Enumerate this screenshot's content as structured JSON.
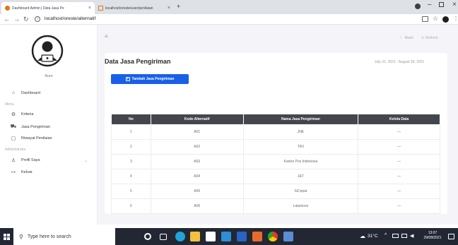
{
  "browser": {
    "tabs": [
      {
        "label": "Dashboard Admin | Data Jasa Pe"
      },
      {
        "label": "localhost/oreste/user/penilaian"
      }
    ],
    "new_tab": "+",
    "address": "localhost/oreste/alternatif"
  },
  "sidebar": {
    "profile_name": "Aure",
    "dashboard": "Dashboard",
    "menu_section": "Menu",
    "items": [
      {
        "label": "Kriteria",
        "icon": "filter-icon"
      },
      {
        "label": "Jasa Pengiriman",
        "icon": "truck-icon"
      },
      {
        "label": "Riwayat Penilaian",
        "icon": "document-icon"
      }
    ],
    "admin_section": "Administrator",
    "profil": "Profil Saya",
    "keluar": "Keluar"
  },
  "topbar": {
    "mode": "Mode",
    "refresh": "Refresh"
  },
  "page": {
    "title": "Data Jasa Pengiriman",
    "date_range": "July 31, 2021 - August 29, 2021",
    "add_button": "Tambah Jasa Pengiriman"
  },
  "table": {
    "headers": [
      "No",
      "Kode Alternatif",
      "Nama Jasa Pengiriman",
      "Kelola Data"
    ],
    "rows": [
      [
        "1",
        "A01",
        "JNE",
        "—"
      ],
      [
        "2",
        "A02",
        "TIKI",
        "—"
      ],
      [
        "3",
        "A03",
        "Kantor Pos Indonesia",
        "—"
      ],
      [
        "4",
        "A04",
        "J&T",
        "—"
      ],
      [
        "5",
        "A05",
        "SiCepat",
        "—"
      ],
      [
        "6",
        "A06",
        "Lalamove",
        "—"
      ]
    ]
  },
  "taskbar": {
    "search_placeholder": "Type here to search",
    "temperature": "31°C",
    "time": "13:07",
    "date": "29/08/2021"
  }
}
